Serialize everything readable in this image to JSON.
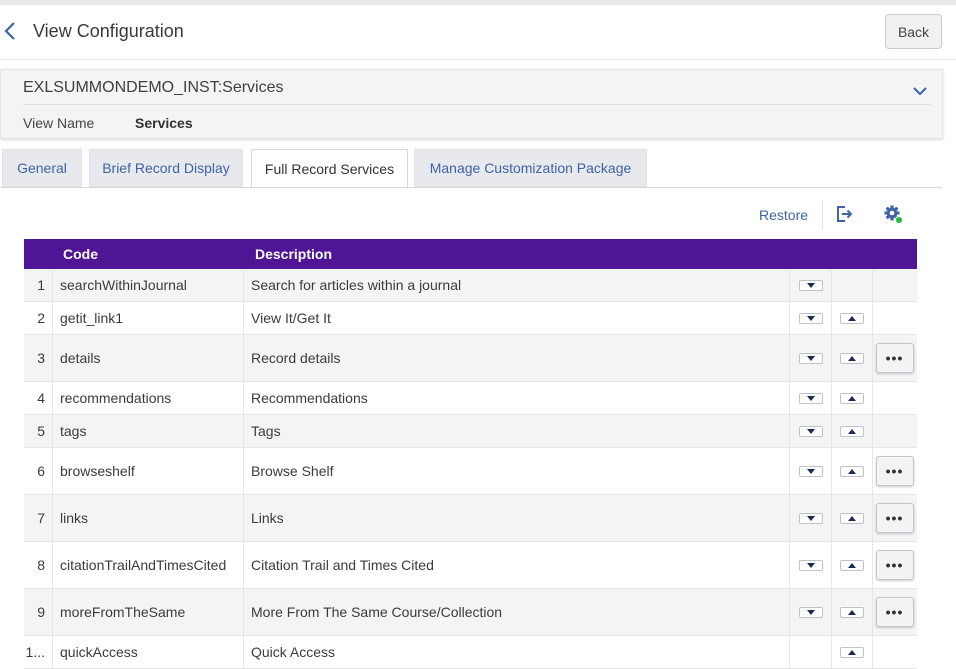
{
  "header": {
    "title": "View Configuration",
    "back_label": "Back"
  },
  "info": {
    "title": "EXLSUMMONDEMO_INST:Services",
    "view_name_label": "View Name",
    "view_name_value": "Services"
  },
  "tabs": [
    {
      "label": "General",
      "active": false
    },
    {
      "label": "Brief Record Display",
      "active": false
    },
    {
      "label": "Full Record Services",
      "active": true
    },
    {
      "label": "Manage Customization Package",
      "active": false
    }
  ],
  "toolbar": {
    "restore_label": "Restore",
    "export_icon": "export-icon",
    "settings_icon": "gear-icon"
  },
  "table": {
    "columns": [
      "",
      "Code",
      "Description"
    ],
    "header_color": "#4f1594",
    "more_label": "•••",
    "rows": [
      {
        "num": "1",
        "code": "searchWithinJournal",
        "desc": "Search for articles within a journal",
        "down": true,
        "up": false,
        "more": false
      },
      {
        "num": "2",
        "code": "getit_link1",
        "desc": "View It/Get It",
        "down": true,
        "up": true,
        "more": false
      },
      {
        "num": "3",
        "code": "details",
        "desc": "Record details",
        "down": true,
        "up": true,
        "more": true
      },
      {
        "num": "4",
        "code": "recommendations",
        "desc": "Recommendations",
        "down": true,
        "up": true,
        "more": false
      },
      {
        "num": "5",
        "code": "tags",
        "desc": "Tags",
        "down": true,
        "up": true,
        "more": false
      },
      {
        "num": "6",
        "code": "browseshelf",
        "desc": "Browse Shelf",
        "down": true,
        "up": true,
        "more": true
      },
      {
        "num": "7",
        "code": "links",
        "desc": "Links",
        "down": true,
        "up": true,
        "more": true
      },
      {
        "num": "8",
        "code": "citationTrailAndTimesCited",
        "desc": "Citation Trail and Times Cited",
        "down": true,
        "up": true,
        "more": true
      },
      {
        "num": "9",
        "code": "moreFromTheSame",
        "desc": "More From The Same Course/Collection",
        "down": true,
        "up": true,
        "more": true
      },
      {
        "num": "1...",
        "code": "quickAccess",
        "desc": "Quick Access",
        "down": false,
        "up": true,
        "more": false
      }
    ]
  }
}
